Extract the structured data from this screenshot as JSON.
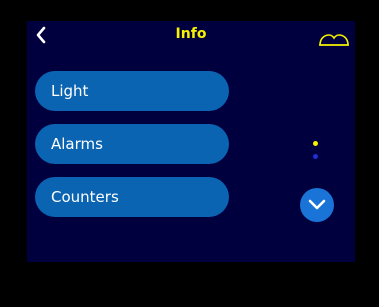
{
  "header": {
    "title": "Info"
  },
  "menu": {
    "items": [
      {
        "label": "Light"
      },
      {
        "label": "Alarms"
      },
      {
        "label": "Counters"
      }
    ]
  },
  "pager": {
    "page_count": 2,
    "current_page": 1
  },
  "icons": {
    "back": "chevron-left-icon",
    "top_right": "mask-icon",
    "scroll": "chevron-down-icon"
  },
  "colors": {
    "screen_background": "#00003f",
    "title": "#f6f200",
    "button": "#0b64b2",
    "active_dot": "#f6f200",
    "inactive_dot": "#1f2fd6"
  }
}
